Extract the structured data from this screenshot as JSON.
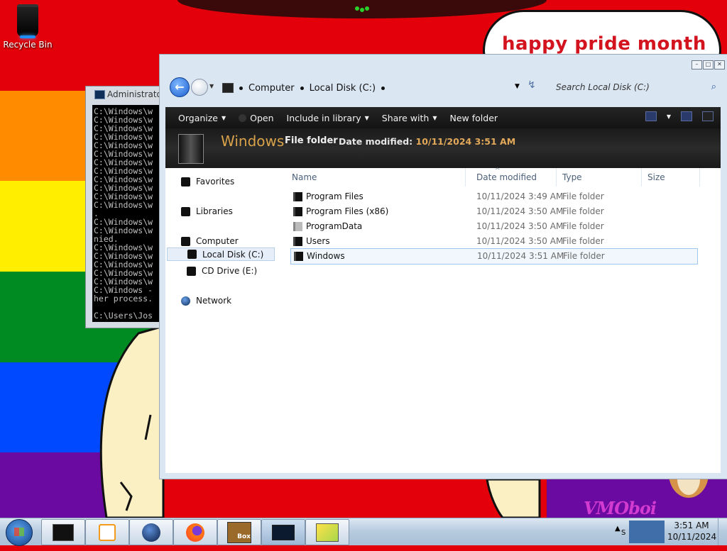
{
  "desktop": {
    "recycle_bin_label": "Recycle Bin",
    "banner_text": "happy pride month",
    "signature_text": "VMOboi"
  },
  "cmd_window": {
    "title": "Administrator",
    "console_lines": [
      "C:\\Windows\\w",
      "C:\\Windows\\w",
      "C:\\Windows\\w",
      "C:\\Windows\\w",
      "C:\\Windows\\w",
      "C:\\Windows\\w",
      "C:\\Windows\\w",
      "C:\\Windows\\w",
      "C:\\Windows\\w",
      "C:\\Windows\\w",
      "C:\\Windows\\w",
      "C:\\Windows\\w",
      ".",
      "C:\\Windows\\w",
      "C:\\Windows\\w",
      "nied.",
      "C:\\Windows\\w",
      "C:\\Windows\\w",
      "C:\\Windows\\w",
      "C:\\Windows\\w",
      "C:\\Windows\\w",
      "C:\\Windows -",
      "her process.",
      "",
      "C:\\Users\\Jos"
    ]
  },
  "explorer": {
    "breadcrumb": [
      "Computer",
      "Local Disk (C:)"
    ],
    "search_placeholder": "Search Local Disk (C:)",
    "toolbar": {
      "organize": "Organize",
      "open": "Open",
      "include_in_library": "Include in library",
      "share_with": "Share with",
      "new_folder": "New folder"
    },
    "details": {
      "name": "Windows",
      "kind": "File folder",
      "date_label": "Date modified:",
      "date_value": "10/11/2024 3:51 AM"
    },
    "nav_pane": {
      "favorites": "Favorites",
      "libraries": "Libraries",
      "computer": "Computer",
      "local_disk": "Local Disk (C:)",
      "cd_drive": "CD Drive (E:)",
      "network": "Network"
    },
    "columns": {
      "name": "Name",
      "date_modified": "Date modified",
      "type": "Type",
      "size": "Size"
    },
    "files": [
      {
        "name": "Program Files",
        "date": "10/11/2024 3:49 AM",
        "type": "File folder"
      },
      {
        "name": "Program Files (x86)",
        "date": "10/11/2024 3:50 AM",
        "type": "File folder"
      },
      {
        "name": "ProgramData",
        "date": "10/11/2024 3:50 AM",
        "type": "File folder"
      },
      {
        "name": "Users",
        "date": "10/11/2024 3:50 AM",
        "type": "File folder"
      },
      {
        "name": "Windows",
        "date": "10/11/2024 3:51 AM",
        "type": "File folder"
      }
    ]
  },
  "taskbar": {
    "clock_time": "3:51 AM",
    "clock_date": "10/11/2024",
    "tray_text": "S",
    "box_app_label": "Box"
  },
  "colors": {
    "wallpaper_red": "#e4000a",
    "rainbow": [
      "#ff8c00",
      "#ffee00",
      "#008a22",
      "#0049ff",
      "#6a0aa0"
    ],
    "accent_gold": "#d9a24a",
    "selection_border": "#9ec6ee"
  }
}
